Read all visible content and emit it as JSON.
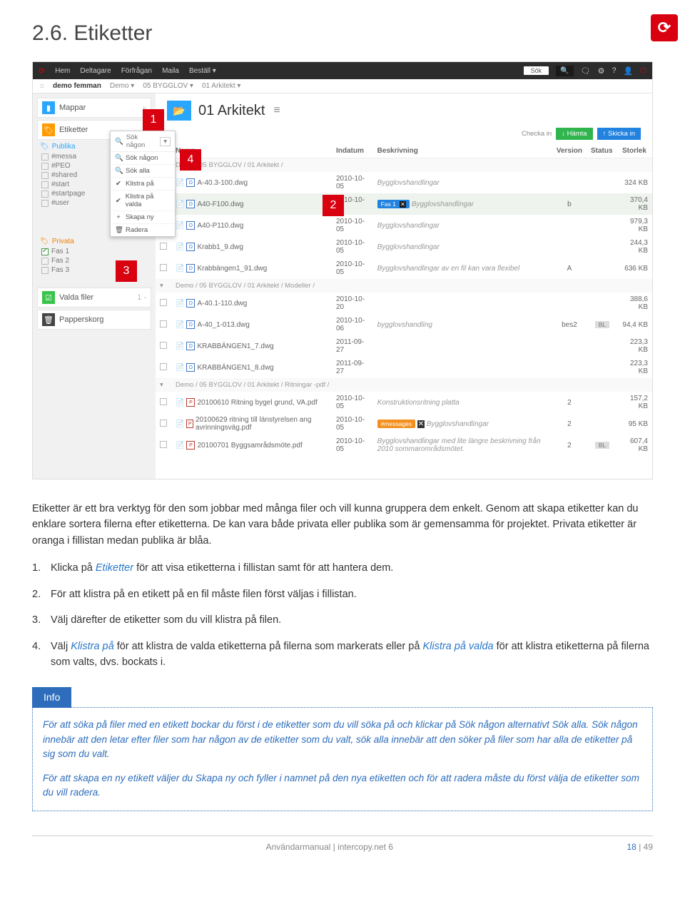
{
  "page_title": "2.6. Etiketter",
  "topbar": {
    "logo_glyph": "⟳",
    "items": [
      "Hem",
      "Deltagare",
      "Förfrågan",
      "Maila",
      "Beställ ▾"
    ],
    "search_placeholder": "Sök",
    "icon_glyphs": [
      "🗨",
      "⚙",
      "?",
      "👤",
      "⏻"
    ]
  },
  "breadcrumb": {
    "home_glyph": "⌂",
    "proj": "demo femman",
    "parts": [
      "Demo ▾",
      "05 BYGGLOV ▾",
      "01 Arkitekt ▾"
    ]
  },
  "sidebar": {
    "mappar": {
      "label": "Mappar",
      "chev": "»"
    },
    "etiketter": {
      "label": "Etiketter"
    },
    "publika": {
      "head": "Publika",
      "items": [
        "#messa",
        "#PEO",
        "#shared",
        "#start",
        "#startpage",
        "#user"
      ]
    },
    "privata": {
      "head": "Privata",
      "items": [
        "Fas 1",
        "Fas 2",
        "Fas 3"
      ],
      "checked": 0
    },
    "valda": {
      "label": "Valda filer",
      "count": "1 -"
    },
    "trash": {
      "label": "Papperskorg"
    }
  },
  "ctx": {
    "search": "Sök någon",
    "items": [
      {
        "ic": "🔍",
        "label": "Sök någon"
      },
      {
        "ic": "🔍",
        "label": "Sök alla"
      },
      {
        "ic": "✔",
        "label": "Klistra på"
      },
      {
        "ic": "✔",
        "label": "Klistra på valda"
      },
      {
        "ic": "+",
        "label": "Skapa ny"
      },
      {
        "ic": "🗑",
        "label": "Radera"
      }
    ]
  },
  "main": {
    "folder_glyph": "📂",
    "title": "01 Arkitekt",
    "ham": "≡",
    "checka": "Checka in",
    "hamta": "↓ Hämta",
    "skicka": "↑ Skicka in",
    "headers": {
      "namn": "Namn",
      "indatum": "Indatum",
      "beskr": "Beskrivning",
      "ver": "Version",
      "status": "Status",
      "storlek": "Storlek"
    },
    "group1_path": "Demo  /  05 BYGGLOV  /  01 Arkitekt  /",
    "rows1": [
      {
        "n": "A-40.3-100.dwg",
        "d": "2010-10-05",
        "b": "Bygglovshandlingar",
        "v": "",
        "s": "",
        "sz": "324 KB"
      },
      {
        "n": "A40-F100.dwg",
        "d": "2010-10-05",
        "b": "Bygglovshandlingar",
        "v": "b",
        "s": "",
        "sz": "370,4 KB",
        "sel": true,
        "tag": "Fas 1"
      },
      {
        "n": "A40-P110.dwg",
        "d": "2010-10-05",
        "b": "Bygglovshandlingar",
        "v": "",
        "s": "",
        "sz": "979,3 KB"
      },
      {
        "n": "Krabb1_9.dwg",
        "d": "2010-10-05",
        "b": "Bygglovshandlingar",
        "v": "",
        "s": "",
        "sz": "244,3 KB"
      },
      {
        "n": "Krabbängen1_91.dwg",
        "d": "2010-10-05",
        "b": "Bygglovshandlingar av en fil kan vara flexibel",
        "v": "A",
        "s": "",
        "sz": "636 KB"
      }
    ],
    "group2_path": "Demo  /  05 BYGGLOV  /  01 Arkitekt  /  Modeller  /",
    "rows2": [
      {
        "n": "A-40.1-110.dwg",
        "d": "2010-10-20",
        "b": "",
        "v": "",
        "s": "",
        "sz": "388,6 KB"
      },
      {
        "n": "A-40_1-013.dwg",
        "d": "2010-10-06",
        "b": "bygglovshandling",
        "v": "bes2",
        "s": "BL",
        "sz": "94,4 KB"
      },
      {
        "n": "KRABBÄNGEN1_7.dwg",
        "d": "2011-09-27",
        "b": "",
        "v": "",
        "s": "",
        "sz": "223,3 KB"
      },
      {
        "n": "KRABBÄNGEN1_8.dwg",
        "d": "2011-09-27",
        "b": "",
        "v": "",
        "s": "",
        "sz": "223,3 KB"
      }
    ],
    "group3_path": "Demo  /  05 BYGGLOV  /  01 Arkitekt  /  Ritningar -pdf  /",
    "rows3": [
      {
        "n": "20100610 Ritning bygel grund, VA.pdf",
        "d": "2010-10-05",
        "b": "Konstruktionsritning platta",
        "v": "2",
        "s": "",
        "sz": "157,2 KB",
        "pdf": true
      },
      {
        "n": "20100629 ritning till länstyrelsen ang avrinningsväg.pdf",
        "d": "2010-10-05",
        "b": "Bygglovshandlingar",
        "v": "2",
        "s": "",
        "sz": "95 KB",
        "pdf": true,
        "otag": "#messages"
      },
      {
        "n": "20100701 Byggsamrådsmöte.pdf",
        "d": "2010-10-05",
        "b": "Bygglovshandlingar med lite längre beskrivning från 2010 sommarområdsmötet.",
        "v": "2",
        "s": "BL",
        "sz": "607,4 KB",
        "pdf": true
      }
    ]
  },
  "prose": {
    "p1": "Etiketter är ett bra verktyg för den som jobbar med många filer och vill kunna gruppera dem enkelt. Genom att skapa etiketter kan du enklare sortera filerna efter etiketterna. De kan vara både privata eller publika som är gemensamma för projektet. Privata etiketter är oranga i fillistan medan publika är blåa.",
    "li1a": "Klicka på ",
    "li1_link": "Etiketter",
    "li1b": " för att visa etiketterna i fillistan samt för att hantera dem.",
    "li2": "För att klistra på en etikett på en fil måste filen först väljas i fillistan.",
    "li3": "Välj därefter de etiketter som du vill klistra på filen.",
    "li4a": "Välj ",
    "li4_l1": "Klistra på",
    "li4b": " för att klistra de valda etiketterna på filerna som markerats eller på ",
    "li4_l2": "Klistra på valda",
    "li4c": " för att klistra etiketterna på filerna som valts, dvs. bockats i."
  },
  "info": {
    "tab": "Info",
    "p1": "För att söka på filer med en etikett bockar du först i de etiketter som du vill söka på och klickar på Sök någon alternativt Sök alla. Sök någon innebär att den letar efter filer som har någon av de etiketter som du valt, sök alla innebär att den söker på filer som har alla de etiketter på sig som du valt.",
    "p2": "För att skapa en ny etikett väljer du Skapa ny och fyller i namnet på den nya etiketten och för att radera måste du först välja de etiketter som du vill radera."
  },
  "footer": {
    "mid": "Användarmanual  |  intercopy.net 6",
    "page": "18",
    "total": " | 49"
  },
  "callouts": {
    "1": "1",
    "2": "2",
    "3": "3",
    "4": "4"
  }
}
